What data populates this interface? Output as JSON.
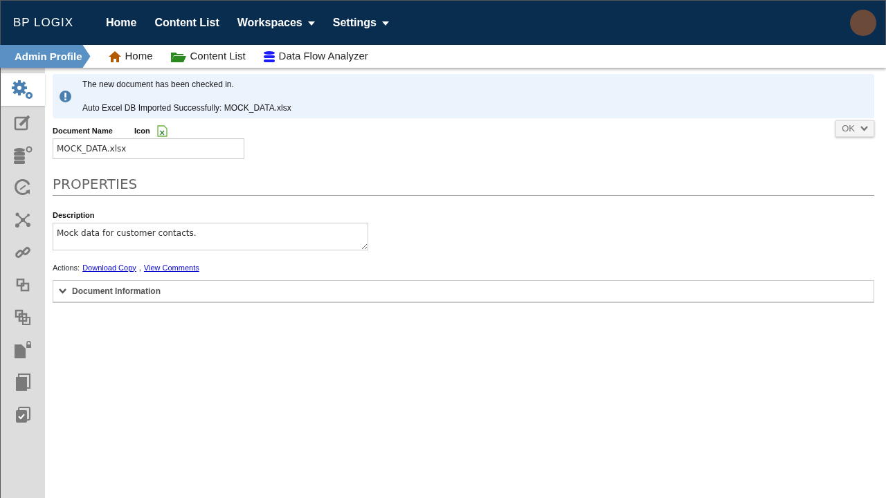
{
  "navbar": {
    "logo": "BP LOGIX",
    "items": [
      {
        "label": "Home",
        "dropdown": false
      },
      {
        "label": "Content List",
        "dropdown": false
      },
      {
        "label": "Workspaces",
        "dropdown": true
      },
      {
        "label": "Settings",
        "dropdown": true
      }
    ]
  },
  "breadcrumb": {
    "profile": "Admin Profile",
    "links": [
      {
        "label": "Home",
        "kind": "home"
      },
      {
        "label": "Content List",
        "kind": "folder"
      },
      {
        "label": "Data Flow Analyzer",
        "kind": "database"
      }
    ]
  },
  "sidebar": {
    "items": [
      {
        "kind": "gears",
        "selected": true
      },
      {
        "kind": "edit",
        "selected": false
      },
      {
        "kind": "dbplus",
        "selected": false
      },
      {
        "kind": "clock",
        "selected": false
      },
      {
        "kind": "network",
        "selected": false
      },
      {
        "kind": "link",
        "selected": false
      },
      {
        "kind": "squares",
        "selected": false
      },
      {
        "kind": "squares2",
        "selected": false
      },
      {
        "kind": "doclock",
        "selected": false
      },
      {
        "kind": "copies",
        "selected": false
      },
      {
        "kind": "check",
        "selected": false
      }
    ]
  },
  "alert": {
    "messages": [
      "The new document has been checked in.",
      "Auto Excel DB Imported Successfully: MOCK_DATA.xlsx"
    ]
  },
  "ok_button": "OK",
  "form": {
    "name_label": "Document Name",
    "icon_label": "Icon",
    "name_value": "MOCK_DATA.xlsx",
    "section_title": "PROPERTIES",
    "description_label": "Description",
    "description_value": "Mock data for customer contacts.",
    "actions_label": "Actions:",
    "actions": [
      "Download Copy",
      "View Comments"
    ],
    "actions_separator": ",",
    "panel_title": "Document Information"
  }
}
